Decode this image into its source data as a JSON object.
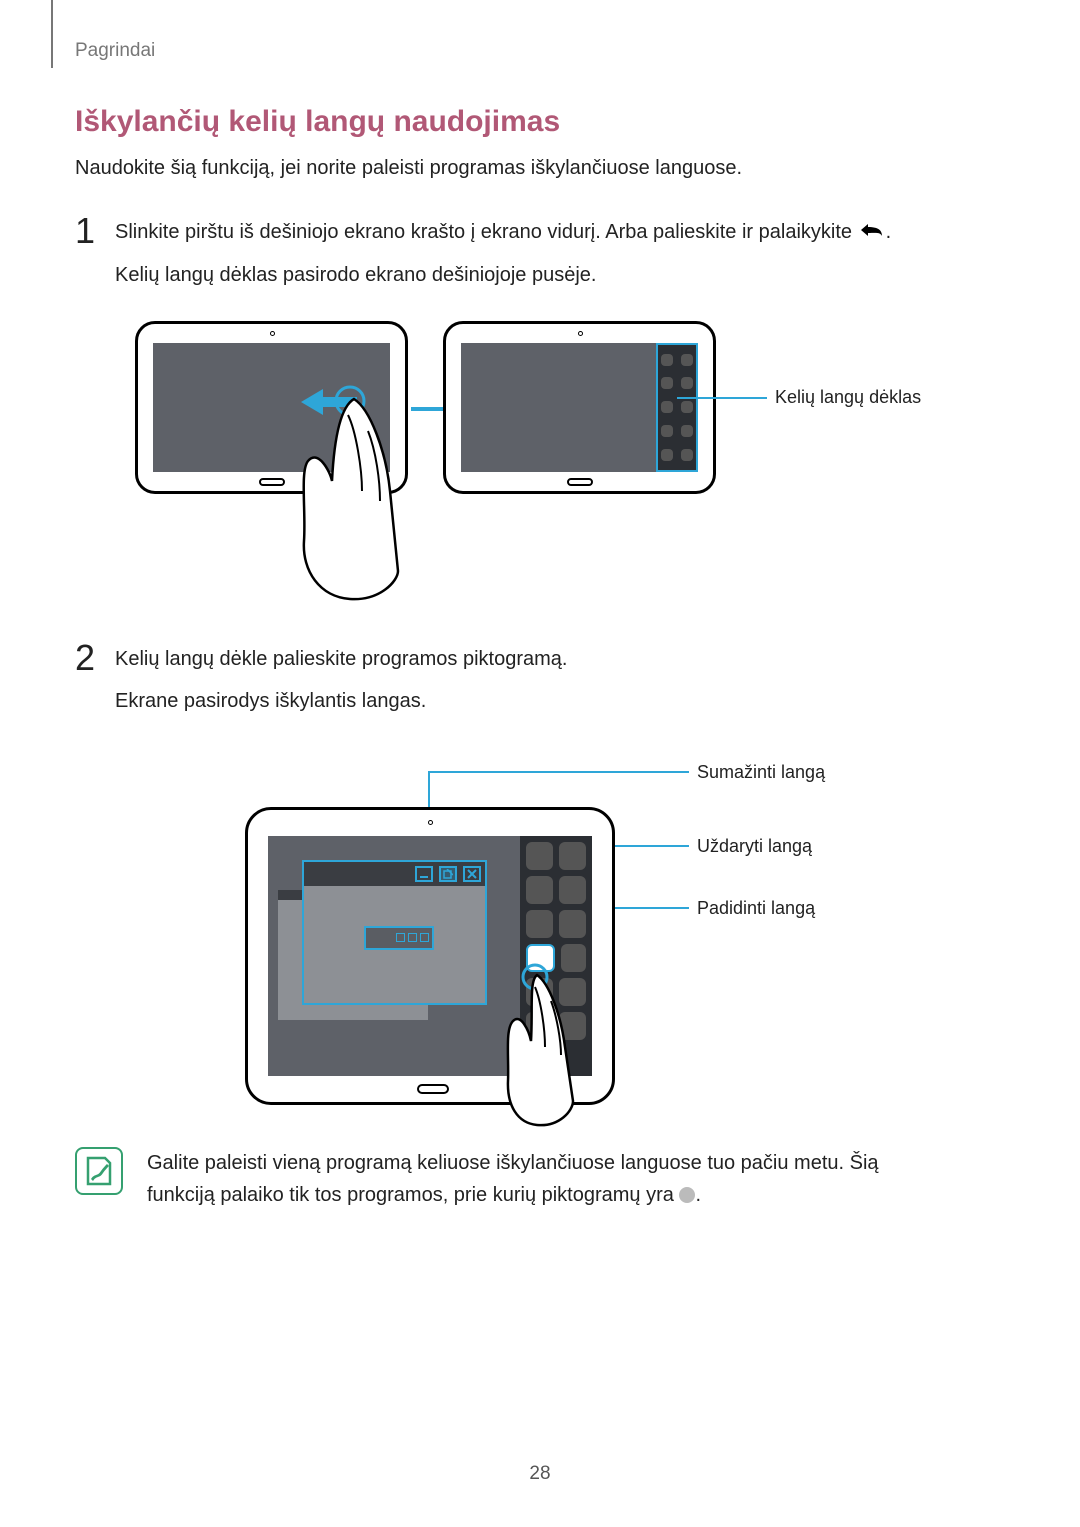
{
  "header": "Pagrindai",
  "heading": "Iškylančių kelių langų naudojimas",
  "intro": "Naudokite šią funkciją, jei norite paleisti programas iškylančiuose languose.",
  "steps": {
    "s1_num": "1",
    "s1_line1_a": "Slinkite pirštu iš dešiniojo ekrano krašto į ekrano vidurį. Arba palieskite ir palaikykite ",
    "s1_line1_b": ".",
    "s1_line2": "Kelių langų dėklas pasirodo ekrano dešiniojoje pusėje.",
    "s2_num": "2",
    "s2_line1": "Kelių langų dėkle palieskite programos piktogramą.",
    "s2_line2": "Ekrane pasirodys iškylantis langas."
  },
  "labels": {
    "tray": "Kelių langų dėklas",
    "minimize": "Sumažinti langą",
    "close": "Uždaryti langą",
    "maximize": "Padidinti langą"
  },
  "note": {
    "line1": "Galite paleisti vieną programą keliuose iškylančiuose languose tuo pačiu metu. Šią",
    "line2a": "funkciją palaiko tik tos programos, prie kurių piktogramų yra ",
    "line2b": "."
  },
  "page_number": "28"
}
